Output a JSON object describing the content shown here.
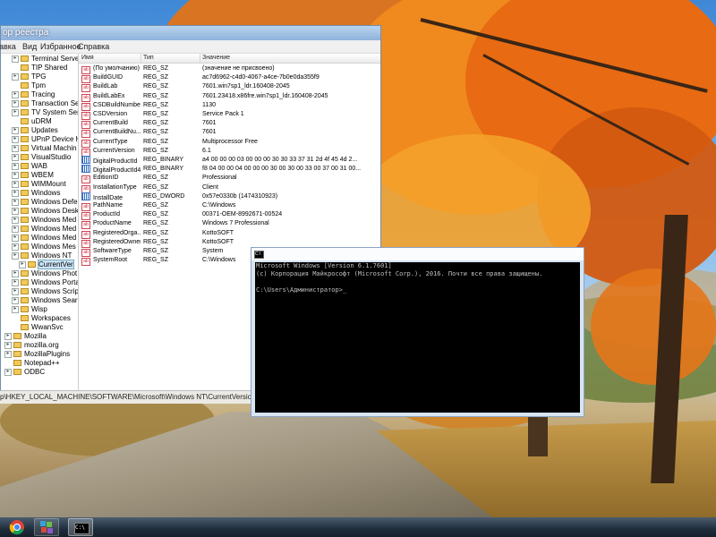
{
  "regedit": {
    "title": "ор реестра",
    "menu": [
      "Вид",
      "Избранное",
      "Справка"
    ],
    "menu_cutoff": "авка",
    "tree": [
      {
        "label": "Terminal Serve",
        "expandable": true
      },
      {
        "label": "TIP Shared",
        "expandable": false
      },
      {
        "label": "TPG",
        "expandable": true
      },
      {
        "label": "Tpm",
        "expandable": false
      },
      {
        "label": "Tracing",
        "expandable": true
      },
      {
        "label": "Transaction Se",
        "expandable": true
      },
      {
        "label": "TV System Ser",
        "expandable": true
      },
      {
        "label": "uDRM",
        "expandable": false
      },
      {
        "label": "Updates",
        "expandable": true
      },
      {
        "label": "UPnP Device H",
        "expandable": true
      },
      {
        "label": "Virtual Machin",
        "expandable": true
      },
      {
        "label": "VisualStudio",
        "expandable": true
      },
      {
        "label": "WAB",
        "expandable": true
      },
      {
        "label": "WBEM",
        "expandable": true
      },
      {
        "label": "WIMMount",
        "expandable": true
      },
      {
        "label": "Windows",
        "expandable": true
      },
      {
        "label": "Windows Defe",
        "expandable": true
      },
      {
        "label": "Windows Desk",
        "expandable": true
      },
      {
        "label": "Windows Med",
        "expandable": true
      },
      {
        "label": "Windows Med",
        "expandable": true
      },
      {
        "label": "Windows Med",
        "expandable": true
      },
      {
        "label": "Windows Mes",
        "expandable": true
      },
      {
        "label": "Windows NT",
        "expandable": true
      },
      {
        "label": "CurrentVer",
        "expandable": true,
        "selected": true,
        "child": true
      },
      {
        "label": "Windows Phot",
        "expandable": true
      },
      {
        "label": "Windows Porta",
        "expandable": true
      },
      {
        "label": "Windows Scrip",
        "expandable": true
      },
      {
        "label": "Windows Searc",
        "expandable": true
      },
      {
        "label": "Wisp",
        "expandable": true
      },
      {
        "label": "Workspaces",
        "expandable": false
      },
      {
        "label": "WwanSvc",
        "expandable": false
      }
    ],
    "tree_lower": [
      {
        "label": "Mozilla",
        "expandable": true
      },
      {
        "label": "mozilla.org",
        "expandable": true
      },
      {
        "label": "MozillaPlugins",
        "expandable": true
      },
      {
        "label": "Notepad++",
        "expandable": false
      },
      {
        "label": "ODBC",
        "expandable": true
      }
    ],
    "columns": [
      "Имя",
      "Тип",
      "Значение"
    ],
    "values": [
      {
        "name": "(По умолчанию)",
        "type": "REG_SZ",
        "data": "(значение не присвоено)",
        "icon": "str"
      },
      {
        "name": "BuildGUID",
        "type": "REG_SZ",
        "data": "ac7d6962-c4d0-4067-a4ce-7b0e0da355f9",
        "icon": "str"
      },
      {
        "name": "BuildLab",
        "type": "REG_SZ",
        "data": "7601.win7sp1_ldr.160408-2045",
        "icon": "str"
      },
      {
        "name": "BuildLabEx",
        "type": "REG_SZ",
        "data": "7601.23418.x86fre.win7sp1_ldr.160408-2045",
        "icon": "str"
      },
      {
        "name": "CSDBuildNumber",
        "type": "REG_SZ",
        "data": "1130",
        "icon": "str"
      },
      {
        "name": "CSDVersion",
        "type": "REG_SZ",
        "data": "Service Pack 1",
        "icon": "str"
      },
      {
        "name": "CurrentBuild",
        "type": "REG_SZ",
        "data": "7601",
        "icon": "str"
      },
      {
        "name": "CurrentBuildNu...",
        "type": "REG_SZ",
        "data": "7601",
        "icon": "str"
      },
      {
        "name": "CurrentType",
        "type": "REG_SZ",
        "data": "Multiprocessor Free",
        "icon": "str"
      },
      {
        "name": "CurrentVersion",
        "type": "REG_SZ",
        "data": "6.1",
        "icon": "str"
      },
      {
        "name": "DigitalProductId",
        "type": "REG_BINARY",
        "data": "a4 00 00 00 03 00 00 00 30 30 33 37 31 2d 4f 45 4d 2...",
        "icon": "bin"
      },
      {
        "name": "DigitalProductId4",
        "type": "REG_BINARY",
        "data": "f8 04 00 00 04 00 00 00 30 00 30 00 33 00 37 00 31 00...",
        "icon": "bin"
      },
      {
        "name": "EditionID",
        "type": "REG_SZ",
        "data": "Professional",
        "icon": "str"
      },
      {
        "name": "InstallationType",
        "type": "REG_SZ",
        "data": "Client",
        "icon": "str"
      },
      {
        "name": "InstallDate",
        "type": "REG_DWORD",
        "data": "0x57e0330b (1474310923)",
        "icon": "bin"
      },
      {
        "name": "PathName",
        "type": "REG_SZ",
        "data": "C:\\Windows",
        "icon": "str"
      },
      {
        "name": "ProductId",
        "type": "REG_SZ",
        "data": "00371-OEM-8992671-00524",
        "icon": "str"
      },
      {
        "name": "ProductName",
        "type": "REG_SZ",
        "data": "Windows 7 Professional",
        "icon": "str"
      },
      {
        "name": "RegisteredOrga...",
        "type": "REG_SZ",
        "data": "KottoSOFT",
        "icon": "str"
      },
      {
        "name": "RegisteredOwner",
        "type": "REG_SZ",
        "data": "KottoSOFT",
        "icon": "str"
      },
      {
        "name": "SoftwareType",
        "type": "REG_SZ",
        "data": "System",
        "icon": "str"
      },
      {
        "name": "SystemRoot",
        "type": "REG_SZ",
        "data": "C:\\Windows",
        "icon": "str"
      }
    ],
    "status_path": "р\\HKEY_LOCAL_MACHINE\\SOFTWARE\\Microsoft\\Windows NT\\CurrentVersion"
  },
  "console": {
    "icon_text": "C:\\",
    "lines": [
      "Microsoft Windows [Version 6.1.7601]",
      "(c) Корпорация Майкрософт (Microsoft Corp.), 2016. Почти все права защищены.",
      "",
      "C:\\Users\\Администратор>_"
    ]
  },
  "taskbar": {
    "apps": [
      {
        "name": "chrome-icon"
      },
      {
        "name": "regedit-icon"
      },
      {
        "name": "cmd-icon",
        "label": "C:\\"
      }
    ]
  },
  "colors": {
    "console_bg": "#000000",
    "console_text": "#c0c0c0",
    "selection": "#cde4f7"
  }
}
